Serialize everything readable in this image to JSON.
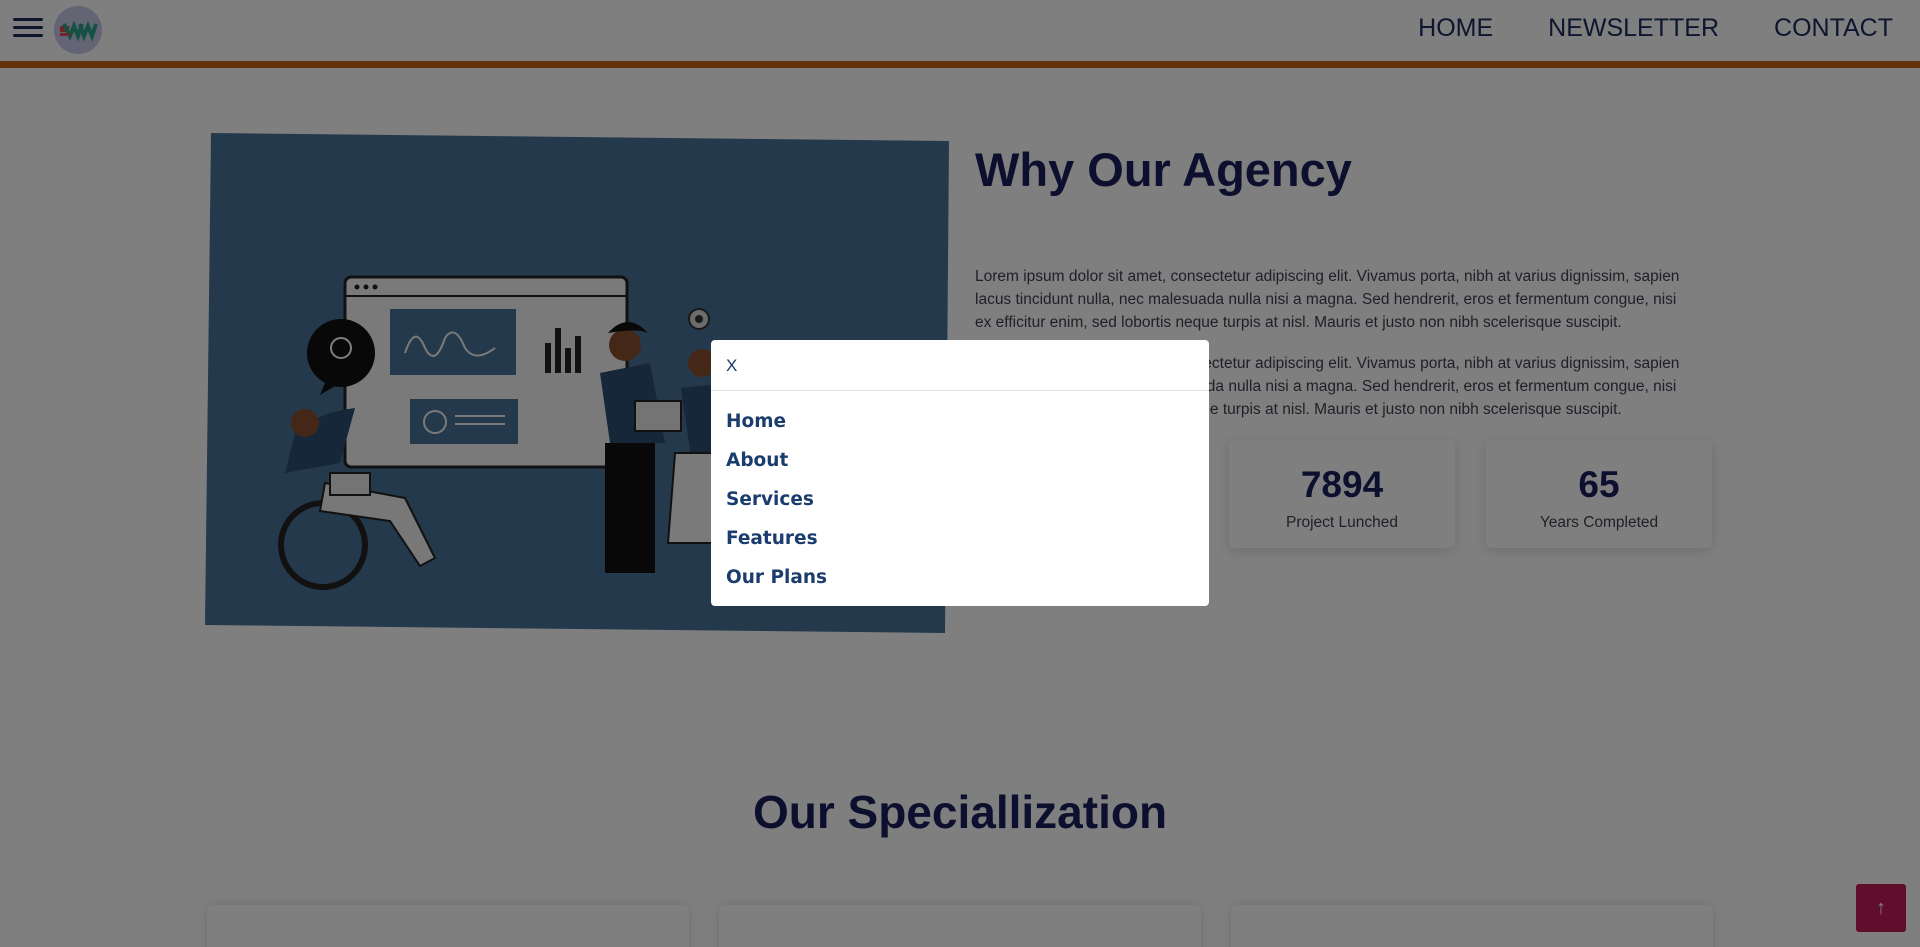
{
  "header": {
    "menu_icon": "hamburger-icon",
    "logo_text": "SW",
    "nav": [
      "HOME",
      "NEWSLETTER",
      "CONTACT"
    ]
  },
  "about": {
    "title": "Why Our Agency",
    "paragraphs": [
      "Lorem ipsum dolor sit amet, consectetur adipiscing elit. Vivamus porta, nibh at varius dignissim, sapien lacus tincidunt nulla, nec malesuada nulla nisi a magna. Sed hendrerit, eros et fermentum congue, nisi ex efficitur enim, sed lobortis neque turpis at nisl. Mauris et justo non nibh scelerisque suscipit.",
      "Lorem ipsum dolor sit amet, consectetur adipiscing elit. Vivamus porta, nibh at varius dignissim, sapien lacus tincidunt nulla, nec malesuada nulla nisi a magna. Sed hendrerit, eros et fermentum congue, nisi ex efficitur enim, sed lobortis neque turpis at nisl. Mauris et justo non nibh scelerisque suscipit."
    ],
    "stats": [
      {
        "number": "7894",
        "label": "Project Lunched"
      },
      {
        "number": "65",
        "label": "Years Completed"
      }
    ]
  },
  "specialization": {
    "title": "Our Speciallization"
  },
  "back_to_top": {
    "icon": "arrow-up-icon",
    "glyph": "↑"
  },
  "modal": {
    "close_label": "X",
    "items": [
      "Home",
      "About",
      "Services",
      "Features",
      "Our Plans"
    ]
  },
  "colors": {
    "accent": "#c8621a",
    "navy": "#1b1f5c",
    "illustration_bg": "#4a7398",
    "back_to_top": "#c21a59"
  }
}
